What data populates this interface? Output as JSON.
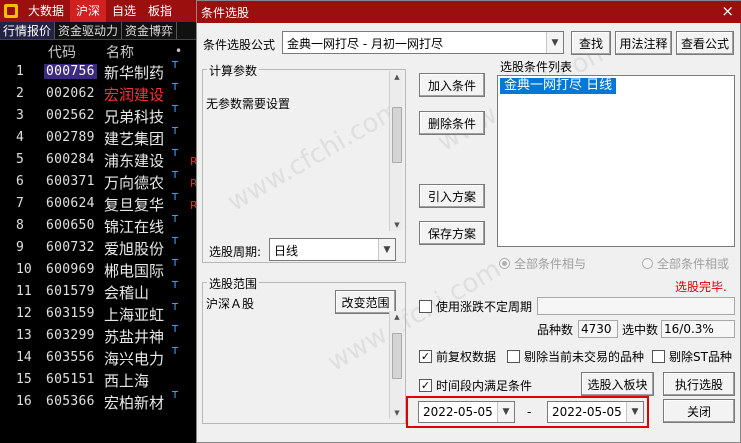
{
  "topbar": {
    "items": [
      {
        "label": "大数据",
        "active": false
      },
      {
        "label": "沪深",
        "active": true
      },
      {
        "label": "自选",
        "active": false
      },
      {
        "label": "板指",
        "active": false
      }
    ]
  },
  "subtabs": [
    "行情报价",
    "资金驱动力",
    "资金博弈"
  ],
  "list_header": {
    "code": "代码",
    "name": "名称",
    "dot": "•"
  },
  "stocks": [
    {
      "idx": "1",
      "code": "000756",
      "name": "新华制药",
      "tag": "T",
      "r": ""
    },
    {
      "idx": "2",
      "code": "002062",
      "name": "宏润建设",
      "tag": "T",
      "r": ""
    },
    {
      "idx": "3",
      "code": "002562",
      "name": "兄弟科技",
      "tag": "T",
      "r": ""
    },
    {
      "idx": "4",
      "code": "002789",
      "name": "建艺集团",
      "tag": "T",
      "r": ""
    },
    {
      "idx": "5",
      "code": "600284",
      "name": "浦东建设",
      "tag": "T",
      "r": "R"
    },
    {
      "idx": "6",
      "code": "600371",
      "name": "万向德农",
      "tag": "T",
      "r": "R"
    },
    {
      "idx": "7",
      "code": "600624",
      "name": "复旦复华",
      "tag": "T",
      "r": "R"
    },
    {
      "idx": "8",
      "code": "600650",
      "name": "锦江在线",
      "tag": "T",
      "r": ""
    },
    {
      "idx": "9",
      "code": "600732",
      "name": "爱旭股份",
      "tag": "T",
      "r": ""
    },
    {
      "idx": "10",
      "code": "600969",
      "name": "郴电国际",
      "tag": "T",
      "r": ""
    },
    {
      "idx": "11",
      "code": "601579",
      "name": "会稽山",
      "tag": "T",
      "r": ""
    },
    {
      "idx": "12",
      "code": "603159",
      "name": "上海亚虹",
      "tag": "T",
      "r": ""
    },
    {
      "idx": "13",
      "code": "603299",
      "name": "苏盐井神",
      "tag": "T",
      "r": ""
    },
    {
      "idx": "14",
      "code": "603556",
      "name": "海兴电力",
      "tag": "T",
      "r": ""
    },
    {
      "idx": "15",
      "code": "605151",
      "name": "西上海",
      "tag": "",
      "r": ""
    },
    {
      "idx": "16",
      "code": "605366",
      "name": "宏柏新材",
      "tag": "T",
      "r": ""
    }
  ],
  "dialog": {
    "title": "条件选股",
    "close": "×",
    "formula_label": "条件选股公式",
    "formula_value": "金典一网打尽 - 月初一网打尽",
    "btn_find": "查找",
    "btn_usage": "用法注释",
    "btn_view": "查看公式",
    "calc_group": "计算参数",
    "calc_text": "无参数需要设置",
    "btn_add": "加入条件",
    "btn_delete": "删除条件",
    "btn_import": "引入方案",
    "btn_save": "保存方案",
    "cond_list_label": "选股条件列表",
    "cond_items": [
      "金典一网打尽  日线"
    ],
    "period_label": "选股周期:",
    "period_value": "日线",
    "radio_and": "全部条件相与",
    "radio_or": "全部条件相或",
    "status_text": "选股完毕.",
    "range_group": "选股范围",
    "range_value": "沪深Ａ股",
    "btn_change_range": "改变范围",
    "chk_uncertain": "使用涨跌不定周期",
    "count_label": "品种数",
    "count_value": "4730",
    "selected_label": "选中数",
    "selected_value": "16/0.3%",
    "chk_fq": "前复权数据",
    "chk_exclude_no_trade": "剔除当前未交易的品种",
    "chk_exclude_st": "剔除ST品种",
    "chk_time_range": "时间段内满足条件",
    "btn_add_to_block": "选股入板块",
    "btn_execute": "执行选股",
    "date_from": "2022-05-05",
    "date_sep": "-",
    "date_to": "2022-05-05",
    "btn_close": "关闭"
  },
  "colors": {
    "titlebar": "#9c0f0f",
    "highlight": "#e00000",
    "status": "#e00000",
    "selection": "#0078d7"
  }
}
